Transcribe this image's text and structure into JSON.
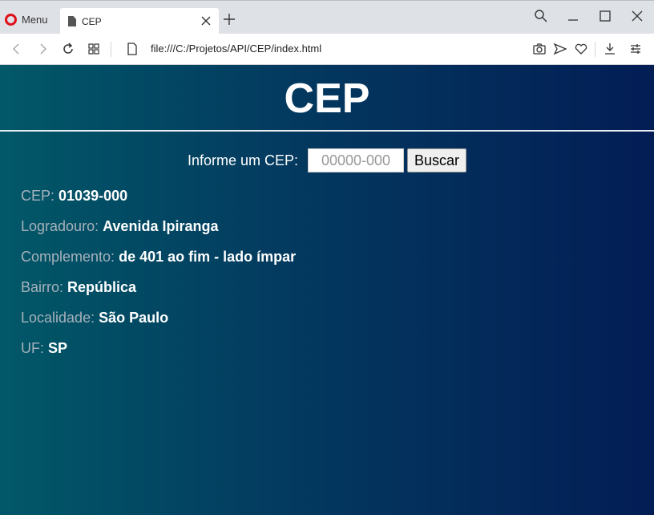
{
  "browser": {
    "menu_label": "Menu",
    "tab_title": "CEP",
    "url": "file:///C:/Projetos/API/CEP/index.html"
  },
  "page": {
    "title": "CEP",
    "search": {
      "label": "Informe um CEP:",
      "placeholder": "00000-000",
      "button_label": "Buscar"
    },
    "fields": [
      {
        "label": "CEP:",
        "value": "01039-000"
      },
      {
        "label": "Logradouro:",
        "value": "Avenida Ipiranga"
      },
      {
        "label": "Complemento:",
        "value": "de 401 ao fim - lado ímpar"
      },
      {
        "label": "Bairro:",
        "value": "República"
      },
      {
        "label": "Localidade:",
        "value": "São Paulo"
      },
      {
        "label": "UF:",
        "value": "SP"
      }
    ]
  },
  "colors": {
    "gradient_start": "#025868",
    "gradient_end": "#031d55",
    "label_color": "#a7b1bb",
    "opera_red": "#e0101a"
  }
}
